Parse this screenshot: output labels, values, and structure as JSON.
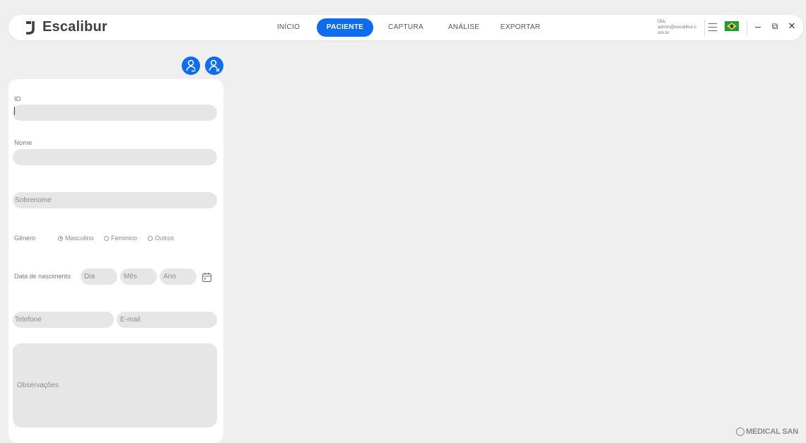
{
  "app": {
    "name": "Escalibur"
  },
  "nav": {
    "items": [
      {
        "label": "INÍCIO",
        "active": false
      },
      {
        "label": "PACIENTE",
        "active": true
      },
      {
        "label": "CAPTURA",
        "active": false
      },
      {
        "label": "ANÁLISE",
        "active": false
      },
      {
        "label": "EXPORTAR",
        "active": false
      }
    ]
  },
  "user": {
    "greeting": "Olá,",
    "email_line1": "admin@escalibur.c",
    "email_line2": "om.br"
  },
  "language": {
    "flag": "brazil-flag-icon"
  },
  "window_controls": {
    "minimize": "–",
    "restore": "⧉",
    "close": "✕"
  },
  "form": {
    "id": {
      "label": "ID",
      "value": ""
    },
    "nome": {
      "label": "Nome",
      "value": ""
    },
    "sobrenome": {
      "placeholder": "Sobrenome"
    },
    "genero": {
      "label": "Gênero",
      "options": [
        "Masculino",
        "Feminino",
        "Outros"
      ],
      "selected": "Masculino"
    },
    "nascimento": {
      "label": "Data de nascimento",
      "dia": "Dia",
      "mes": "Mês",
      "ano": "Ano"
    },
    "telefone": {
      "placeholder": "Telefone"
    },
    "email": {
      "placeholder": "E-mail"
    },
    "observacoes": {
      "placeholder": "Observações"
    }
  },
  "footer": {
    "brand": "MEDICAL SAN"
  },
  "colors": {
    "accent": "#0d6cf0",
    "background": "#efefef",
    "field": "#e6e6e6"
  }
}
